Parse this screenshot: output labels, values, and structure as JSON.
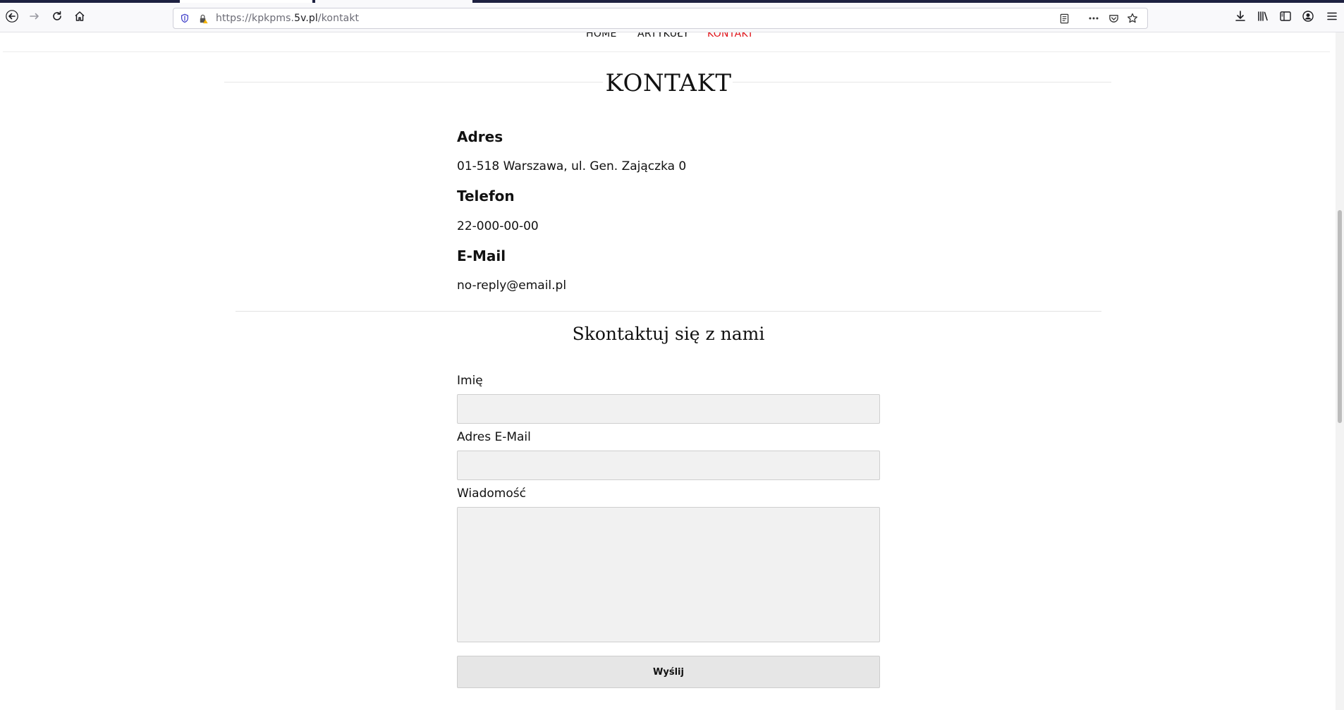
{
  "browser": {
    "url_prefix": "https://kpkpms.",
    "url_host": "5v.pl",
    "url_path": "/kontakt",
    "icons": {
      "back": "back-arrow-icon",
      "forward": "forward-arrow-icon",
      "reload": "reload-icon",
      "home": "home-icon",
      "tracking": "shield-icon",
      "lock": "lock-warning-icon",
      "reader": "reader-view-icon",
      "more": "more-dots-icon",
      "pocket": "pocket-icon",
      "bookmark": "star-icon",
      "downloads": "download-icon",
      "library": "library-icon",
      "sidebar": "sidebar-icon",
      "account": "account-icon",
      "menu": "hamburger-menu-icon"
    }
  },
  "nav": {
    "items": [
      {
        "label": "HOME",
        "active": false
      },
      {
        "label": "ARTYKUŁY",
        "active": false
      },
      {
        "label": "KONTAKT",
        "active": true
      }
    ],
    "active_color": "#e0141a"
  },
  "page": {
    "title": "KONTAKT"
  },
  "contact": {
    "address_label": "Adres",
    "address_value": "01-518 Warszawa, ul. Gen. Zajączka 0",
    "phone_label": "Telefon",
    "phone_value": "22-000-00-00",
    "email_label": "E-Mail",
    "email_value": "no-reply@email.pl"
  },
  "form": {
    "title": "Skontaktuj się z nami",
    "name_label": "Imię",
    "name_value": "",
    "email_label": "Adres E-Mail",
    "email_value": "",
    "message_label": "Wiadomość",
    "message_value": "",
    "submit_label": "Wyślij"
  }
}
